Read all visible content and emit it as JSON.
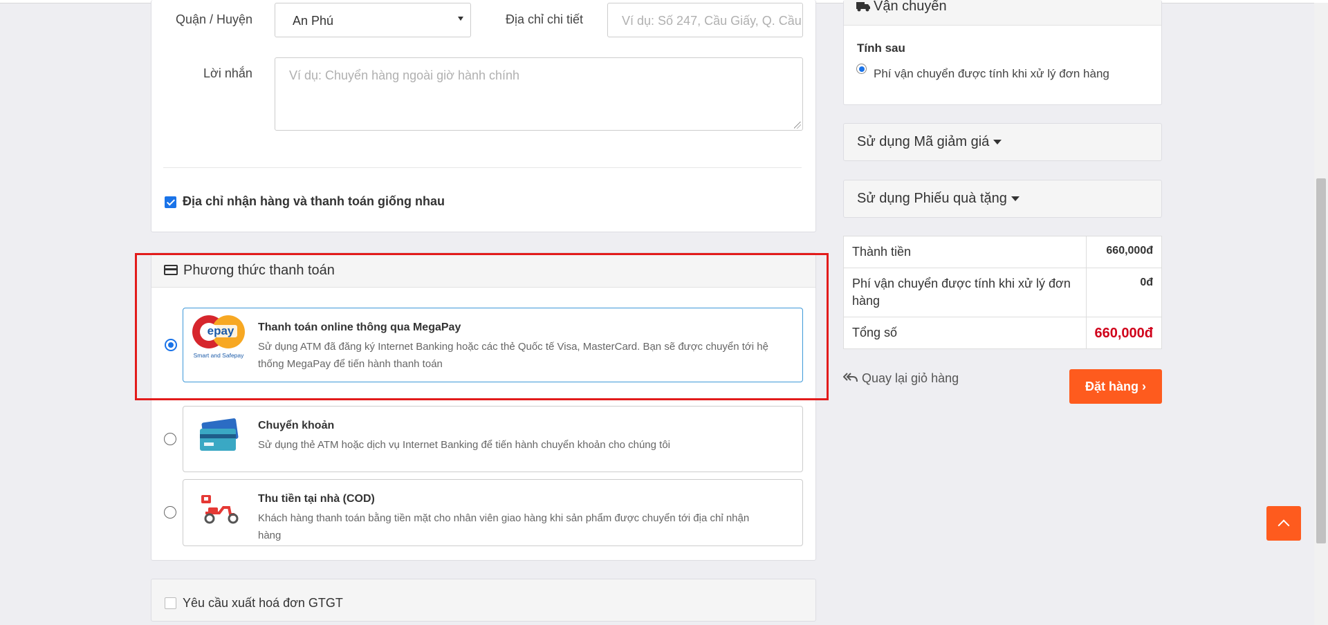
{
  "address": {
    "district_label": "Quận / Huyện",
    "district_value": "An Phú",
    "detail_label": "Địa chỉ chi tiết",
    "detail_placeholder": "Ví dụ: Số 247, Cầu Giấy, Q. Cầu Giấy",
    "message_label": "Lời nhắn",
    "message_placeholder": "Ví dụ: Chuyển hàng ngoài giờ hành chính",
    "same_address_label": "Địa chỉ nhận hàng và thanh toán giống nhau",
    "same_address_checked": true
  },
  "payment": {
    "title": "Phương thức thanh toán",
    "options": [
      {
        "title": "Thanh toán online thông qua MegaPay",
        "desc": "Sử dụng ATM đã đăng ký Internet Banking hoặc các thẻ Quốc tế Visa, MasterCard. Bạn sẽ được chuyển tới hệ thống MegaPay để tiến hành thanh toán",
        "logo_text": "epay",
        "logo_sub": "Smart and Safepay",
        "selected": true
      },
      {
        "title": "Chuyển khoản",
        "desc": "Sử dụng thẻ ATM hoặc dịch vụ Internet Banking để tiến hành chuyển khoản cho chúng tôi",
        "icon": "bank-cards-icon",
        "selected": false
      },
      {
        "title": "Thu tiền tại nhà (COD)",
        "desc": "Khách hàng thanh toán bằng tiền mặt cho nhân viên giao hàng khi sản phẩm được chuyển tới địa chỉ nhận hàng",
        "icon": "delivery-scooter-icon",
        "selected": false
      }
    ]
  },
  "invoice": {
    "label": "Yêu cầu xuất hoá đơn GTGT",
    "checked": false
  },
  "shipping": {
    "title": "Vận chuyển",
    "method_title": "Tính sau",
    "method_desc": "Phí vận chuyển được tính khi xử lý đơn hàng"
  },
  "coupon": {
    "label": "Sử dụng Mã giảm giá"
  },
  "gift": {
    "label": "Sử dụng Phiếu quà tặng"
  },
  "summary": {
    "rows": [
      {
        "label": "Thành tiền",
        "value": "660,000đ"
      },
      {
        "label": "Phí vận chuyển được tính khi xử lý đơn hàng",
        "value": "0đ"
      },
      {
        "label": "Tổng số",
        "value": "660,000đ"
      }
    ]
  },
  "actions": {
    "back_label": "Quay lại giỏ hàng",
    "order_label": "Đặt hàng"
  },
  "colors": {
    "accent": "#fe5b1e",
    "total_red": "#d0021b",
    "highlight": "#e21b1b",
    "selected_border": "#3c98d8"
  }
}
